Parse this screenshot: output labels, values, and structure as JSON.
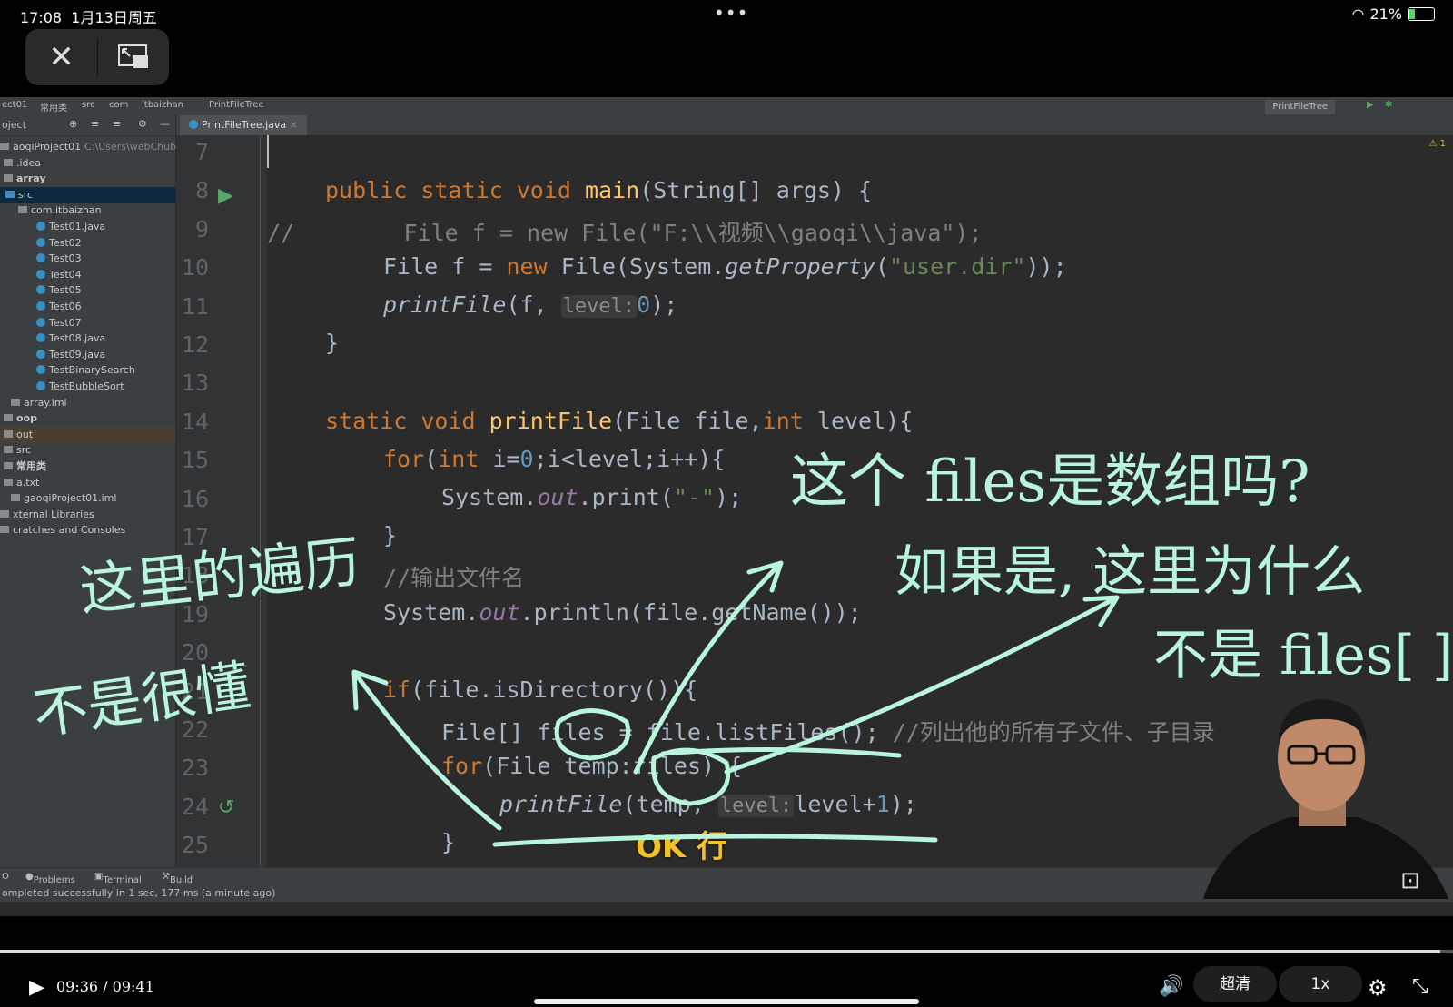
{
  "status": {
    "time": "17:08",
    "date": "1月13日周五",
    "battery": "21%"
  },
  "overlay_controls": {
    "close_icon": "close-icon",
    "pip_icon": "exit-pip-icon"
  },
  "ide": {
    "breadcrumb": [
      "ect01",
      "常用类",
      "src",
      "com",
      "itbaizhan",
      "PrintFileTree"
    ],
    "run_config": "PrintFileTree",
    "project_header": "oject",
    "tab": "PrintFileTree.java",
    "tree": [
      {
        "label": "aoqiProject01",
        "extra": "C:\\Users\\webChubby",
        "kind": "root"
      },
      {
        "label": ".idea",
        "kind": "dir"
      },
      {
        "label": "array",
        "kind": "dir"
      },
      {
        "label": "src",
        "kind": "src"
      },
      {
        "label": "com.itbaizhan",
        "kind": "pkg"
      },
      {
        "label": "Test01.java",
        "kind": "file"
      },
      {
        "label": "Test02",
        "kind": "file"
      },
      {
        "label": "Test03",
        "kind": "file"
      },
      {
        "label": "Test04",
        "kind": "file"
      },
      {
        "label": "Test05",
        "kind": "file"
      },
      {
        "label": "Test06",
        "kind": "file"
      },
      {
        "label": "Test07",
        "kind": "file"
      },
      {
        "label": "Test08.java",
        "kind": "file"
      },
      {
        "label": "Test09.java",
        "kind": "file"
      },
      {
        "label": "TestBinarySearch",
        "kind": "file"
      },
      {
        "label": "TestBubbleSort",
        "kind": "file"
      },
      {
        "label": "array.iml",
        "kind": "iml"
      },
      {
        "label": "oop",
        "kind": "dir"
      },
      {
        "label": "out",
        "kind": "out"
      },
      {
        "label": "src",
        "kind": "dir"
      },
      {
        "label": "常用类",
        "kind": "dir"
      },
      {
        "label": "a.txt",
        "kind": "txt"
      },
      {
        "label": "gaoqiProject01.iml",
        "kind": "iml"
      },
      {
        "label": "xternal Libraries",
        "kind": "lib"
      },
      {
        "label": "cratches and Consoles",
        "kind": "lib"
      }
    ],
    "line_numbers": [
      "7",
      "8",
      "9",
      "10",
      "11",
      "12",
      "13",
      "14",
      "15",
      "16",
      "17",
      "18",
      "19",
      "20",
      "21",
      "22",
      "23",
      "24",
      "25"
    ],
    "code": {
      "l8": [
        "public static void ",
        "main",
        "(String[] args) {"
      ],
      "l9": [
        "//",
        "        File f = new File(\"F:\\\\视频\\\\gaoqi\\\\java\");"
      ],
      "l10": [
        "File f = ",
        "new ",
        "File(System.",
        "getProperty",
        "(",
        "\"user.dir\"",
        "));"
      ],
      "l11": [
        "printFile",
        "(f, ",
        "level:",
        "0",
        ");"
      ],
      "l12": [
        "}"
      ],
      "l14": [
        "static void ",
        "printFile",
        "(File file,",
        "int ",
        "level){"
      ],
      "l15": [
        "for",
        "(",
        "int ",
        "i=",
        "0",
        ";i<level;i++){"
      ],
      "l16": [
        "System.",
        "out",
        ".print(",
        "\"-\"",
        ");"
      ],
      "l17": [
        "}"
      ],
      "l18": [
        "//输出文件名"
      ],
      "l19": [
        "System.",
        "out",
        ".println(file.getName());"
      ],
      "l21": [
        "if",
        "(file.isDirectory()){"
      ],
      "l22": [
        "File[] files = file.listFiles(); ",
        "//列出他的所有子文件、子目录"
      ],
      "l23": [
        "for",
        "(File temp:files) {"
      ],
      "l24": [
        "printFile",
        "(temp, ",
        "level:",
        "level+",
        "1",
        ");"
      ],
      "l25": [
        "}"
      ]
    },
    "bottom_tabs": [
      "O",
      "Problems",
      "Terminal",
      "Build"
    ],
    "status_text": "ompleted successfully in 1 sec, 177 ms (a minute ago)",
    "warning_badge": "⚠ 1"
  },
  "annotations": {
    "top_right_1": "这个 files是数组吗?",
    "top_right_2": "如果是, 这里为什么",
    "top_right_3": "不是 files[ ].",
    "left_1": "这里的遍历",
    "left_2": "不是很懂"
  },
  "subtitle": "OK 行",
  "player": {
    "time": "09:36 / 09:41",
    "progress": 0.991,
    "quality": "超清",
    "speed": "1x"
  },
  "colors": {
    "ink": "#b8f5dc",
    "subtitle": "#f2c029",
    "keyword": "#cc7832"
  }
}
